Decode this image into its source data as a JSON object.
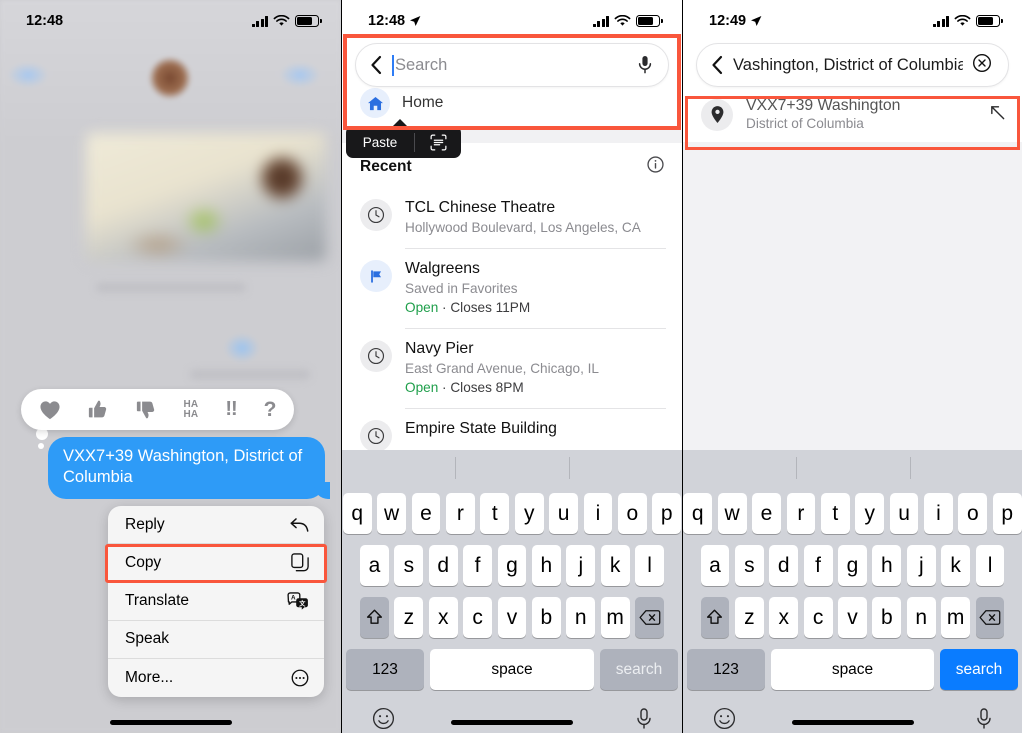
{
  "panels": {
    "left": {
      "status": {
        "time": "12:48",
        "location_arrow": false
      },
      "tapback": {
        "options": [
          "heart",
          "thumbs-up",
          "thumbs-down",
          "haha",
          "exclamation",
          "question"
        ],
        "haha_line1": "HA",
        "haha_line2": "HA",
        "exclamation": "!!",
        "question": "?"
      },
      "message": {
        "text": "VXX7+39 Washington, District of Columbia"
      },
      "context_menu": {
        "items": [
          {
            "label": "Reply",
            "icon": "reply-arrow-icon"
          },
          {
            "label": "Copy",
            "icon": "copy-icon"
          },
          {
            "label": "Translate",
            "icon": "translate-icon"
          },
          {
            "label": "Speak",
            "icon": "speak-icon"
          },
          {
            "label": "More...",
            "icon": "ellipsis-circle-icon"
          }
        ],
        "highlighted": "Copy"
      }
    },
    "mid": {
      "status": {
        "time": "12:48",
        "location_arrow": true
      },
      "search": {
        "value": "",
        "placeholder": "Search",
        "mic_icon": "microphone-icon",
        "back_icon": "chevron-left-icon"
      },
      "paste_popup": {
        "label": "Paste",
        "icon": "scan-text-icon"
      },
      "shortcut": {
        "label": "Home",
        "icon": "home-icon"
      },
      "recent": {
        "title": "Recent",
        "info_icon": "info-circle-icon",
        "items": [
          {
            "icon": "clock-icon",
            "title": "TCL Chinese Theatre",
            "subtitle": "Hollywood Boulevard, Los Angeles, CA",
            "status": "",
            "hours": ""
          },
          {
            "icon": "flag-icon",
            "title": "Walgreens",
            "subtitle": "Saved in Favorites",
            "status": "Open",
            "hours": "Closes 11PM"
          },
          {
            "icon": "clock-icon",
            "title": "Navy Pier",
            "subtitle": "East Grand Avenue, Chicago, IL",
            "status": "Open",
            "hours": "Closes 8PM"
          },
          {
            "icon": "clock-icon",
            "title": "Empire State Building",
            "subtitle": "",
            "status": "",
            "hours": ""
          }
        ]
      },
      "keyboard": {
        "return_key": "search",
        "return_active": false
      }
    },
    "right": {
      "status": {
        "time": "12:49",
        "location_arrow": true
      },
      "search": {
        "value": "Vashington, District of Columbia",
        "placeholder": "",
        "clear_icon": "clear-circle-icon",
        "back_icon": "chevron-left-icon"
      },
      "suggestion": {
        "icon": "map-pin-icon",
        "title": "VXX7+39 Washington",
        "subtitle": "District of Columbia",
        "action_icon": "arrow-up-left-icon"
      },
      "keyboard": {
        "return_key": "search",
        "return_active": true
      }
    }
  },
  "keyboard": {
    "row1": [
      "q",
      "w",
      "e",
      "r",
      "t",
      "y",
      "u",
      "i",
      "o",
      "p"
    ],
    "row2": [
      "a",
      "s",
      "d",
      "f",
      "g",
      "h",
      "j",
      "k",
      "l"
    ],
    "row3": [
      "z",
      "x",
      "c",
      "v",
      "b",
      "n",
      "m"
    ],
    "shift_icon": "shift-icon",
    "backspace_icon": "backspace-icon",
    "numbers_key": "123",
    "space_key": "space",
    "emoji_icon": "emoji-icon",
    "dictation_icon": "microphone-icon"
  },
  "colors": {
    "highlight": "#f9563c",
    "bubble": "#2e9bf7",
    "accent_blue": "#0a7cff",
    "open_green": "#1f9f4b"
  }
}
